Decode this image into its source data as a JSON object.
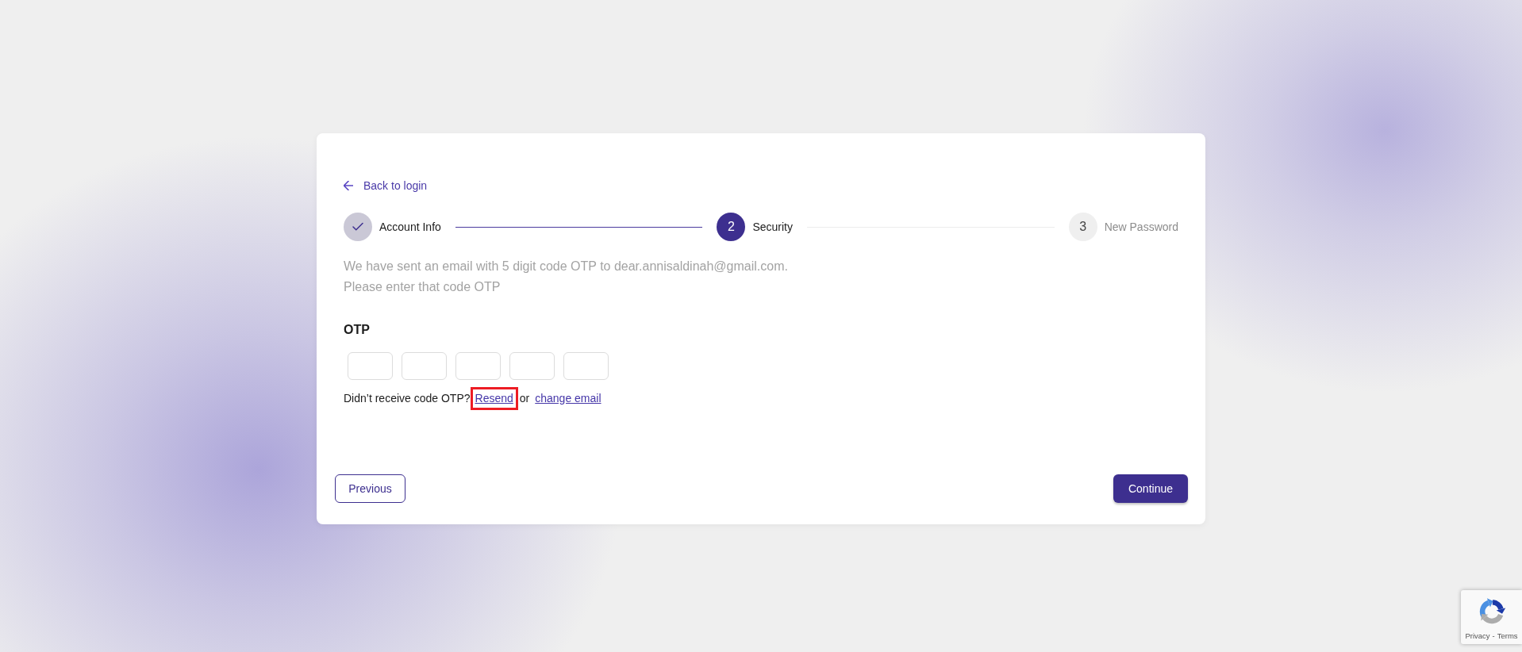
{
  "back_link": {
    "label": "Back to login"
  },
  "stepper": {
    "steps": [
      {
        "label": "Account Info",
        "completed": true
      },
      {
        "number": "2",
        "label": "Security",
        "completed": false
      },
      {
        "number": "3",
        "label": "New Password",
        "completed": false
      }
    ]
  },
  "message_lines": [
    "We have sent an email with 5 digit code OTP to dear.annisaldinah@gmail.com.",
    "Please enter that code OTP"
  ],
  "otp": {
    "label": "OTP",
    "digits": [
      {
        "focused": false
      },
      {
        "focused": false
      },
      {
        "focused": false
      },
      {
        "focused": false
      },
      {
        "focused": false
      }
    ]
  },
  "resend_row": {
    "prompt": "Didn’t receive code OTP?",
    "resend_link": {
      "label": "Resend",
      "highlighted": true
    },
    "separator": "or",
    "change_email_link": {
      "label": "change email"
    }
  },
  "footer": {
    "previous_button": {
      "label": "Previous"
    },
    "continue_button": {
      "label": "Continue"
    }
  },
  "captcha_badge": {
    "privacy_link": "Privacy",
    "separator": "-",
    "terms_link": "Terms"
  }
}
